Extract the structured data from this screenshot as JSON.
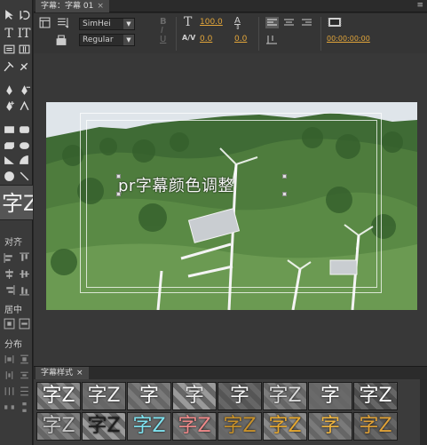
{
  "tools": {
    "align_label": "对齐",
    "center_label": "居中",
    "distribute_label": "分布",
    "sample_text": "字Z"
  },
  "tab": {
    "title": "字幕：字幕 01",
    "close": "×",
    "menu": "≡"
  },
  "toolbar": {
    "font_family": "SimHei",
    "font_style": "Regular",
    "bold": "B",
    "italic": "I",
    "underline": "U",
    "font_size_icon": "T",
    "font_size": "100.0",
    "kerning_icon": "A/V",
    "kerning": "0.0",
    "leading_icon": "A",
    "leading": "0.0",
    "timecode": "00:00:00:00"
  },
  "canvas": {
    "caption": "pr字幕颜色调整"
  },
  "styles_panel": {
    "title": "字幕样式",
    "close": "×",
    "swatches": [
      {
        "text": "字Z",
        "color": "#ffffff",
        "bg": "#8a8a8a"
      },
      {
        "text": "字Z",
        "color": "#f3f3f3",
        "bg": "#6d6d6d"
      },
      {
        "text": "字",
        "color": "#ffffff",
        "bg": "#7a7a7a"
      },
      {
        "text": "字",
        "color": "#e9e9e9",
        "bg": "#9a9a9a"
      },
      {
        "text": "字",
        "color": "#f5f5f5",
        "bg": "#555555"
      },
      {
        "text": "字Z",
        "color": "#dcdcdc",
        "bg": "#7c7c7c"
      },
      {
        "text": "字",
        "color": "#ffffff",
        "bg": "#6a6a6a"
      },
      {
        "text": "字Z",
        "color": "#ffffff",
        "bg": "#4c4c4c"
      },
      {
        "text": "字Z",
        "color": "#c9c9c9",
        "bg": "#7e7e7e"
      },
      {
        "text": "字Z",
        "color": "#1e1e1e",
        "bg": "#9a9a9a"
      },
      {
        "text": "字Z",
        "color": "#7fe3f0",
        "bg": "#666666"
      },
      {
        "text": "字Z",
        "color": "#f08a8a",
        "bg": "#777777"
      },
      {
        "text": "字Z",
        "color": "#c9922a",
        "bg": "#6b6b6b"
      },
      {
        "text": "字Z",
        "color": "#e6a830",
        "bg": "#8a8a8a"
      },
      {
        "text": "字",
        "color": "#f0b640",
        "bg": "#7a7a7a"
      },
      {
        "text": "字Z",
        "color": "#e0a238",
        "bg": "#555555"
      }
    ]
  }
}
